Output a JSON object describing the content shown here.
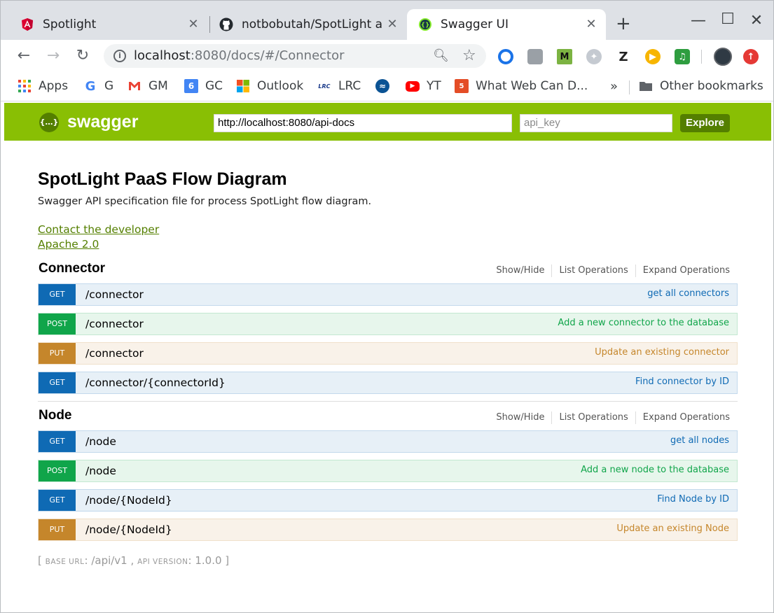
{
  "browser": {
    "tabs": [
      {
        "title": "Spotlight",
        "icon": "angular-icon"
      },
      {
        "title": "notbobutah/SpotLight at",
        "icon": "github-icon"
      },
      {
        "title": "Swagger UI",
        "icon": "swagger-icon"
      }
    ],
    "new_tab": "+",
    "url_host": "localhost",
    "url_rest": ":8080/docs/#/Connector",
    "bookmarks": [
      {
        "label": "Apps",
        "icon": "apps-grid-icon"
      },
      {
        "label": "G",
        "icon": "google-icon"
      },
      {
        "label": "GM",
        "icon": "gmail-icon"
      },
      {
        "label": "GC",
        "icon": "google-calendar-icon"
      },
      {
        "label": "Outlook",
        "icon": "microsoft-icon"
      },
      {
        "label": "LRC",
        "icon": "lrc-icon"
      },
      {
        "label": "",
        "icon": "wave-icon"
      },
      {
        "label": "YT",
        "icon": "youtube-icon"
      },
      {
        "label": "What Web Can D...",
        "icon": "html5-icon"
      }
    ],
    "bookmarks_more": "»",
    "other_bookmarks": "Other bookmarks",
    "bm_icon_text": {
      "calendar": "6",
      "lrc": "LRC"
    },
    "ext_icon_text": {
      "m": "M",
      "z": "Z"
    }
  },
  "swagger": {
    "brand": "swagger",
    "logo_text": "{…}",
    "url_value": "http://localhost:8080/api-docs",
    "api_key_placeholder": "api_key",
    "explore_label": "Explore",
    "title": "SpotLight PaaS Flow Diagram",
    "description": "Swagger API specification file for process SpotLight flow diagram.",
    "contact_link": "Contact the developer",
    "license_link": "Apache 2.0",
    "resource_actions": {
      "show_hide": "Show/Hide",
      "list": "List Operations",
      "expand": "Expand Operations"
    },
    "resources": [
      {
        "name": "Connector",
        "operations": [
          {
            "method": "GET",
            "path": "/connector",
            "summary": "get all connectors"
          },
          {
            "method": "POST",
            "path": "/connector",
            "summary": "Add a new connector to the database"
          },
          {
            "method": "PUT",
            "path": "/connector",
            "summary": "Update an existing connector"
          },
          {
            "method": "GET",
            "path": "/connector/{connectorId}",
            "summary": "Find connector by ID"
          }
        ]
      },
      {
        "name": "Node",
        "operations": [
          {
            "method": "GET",
            "path": "/node",
            "summary": "get all nodes"
          },
          {
            "method": "POST",
            "path": "/node",
            "summary": "Add a new node to the database"
          },
          {
            "method": "GET",
            "path": "/node/{NodeId}",
            "summary": "Find Node by ID"
          },
          {
            "method": "PUT",
            "path": "/node/{NodeId}",
            "summary": "Update an existing Node"
          }
        ]
      }
    ],
    "footer": {
      "open": "[",
      "base_url_label": "BASE URL",
      "base_url_value": ": /api/v1 ,",
      "api_version_label": "API VERSION",
      "api_version_value": ": 1.0.0 ]"
    }
  },
  "colors": {
    "swagger_green": "#89bf04",
    "swagger_dark_green": "#547f00",
    "get": "#0f6ab4",
    "post": "#10a54a",
    "put": "#c5862b"
  }
}
